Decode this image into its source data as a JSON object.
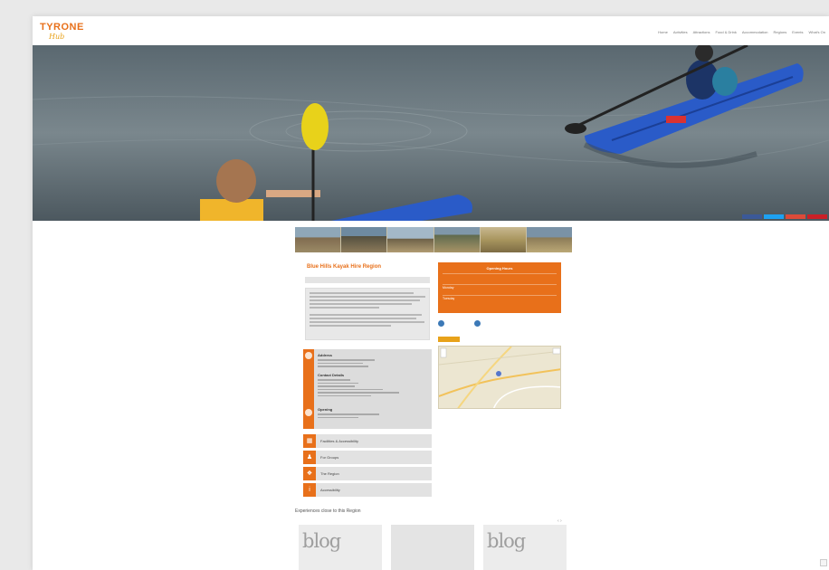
{
  "brand": {
    "logo_main": "TYRONE",
    "logo_sub": "Hub"
  },
  "nav": {
    "top_right": "",
    "items": [
      "Home",
      "Activities",
      "Attractions",
      "Food & Drink",
      "Accommodation",
      "Regions",
      "Events",
      "What's On"
    ]
  },
  "share_colors": [
    "#3b5998",
    "#1da1f2",
    "#dd4b39",
    "#cb2027"
  ],
  "page": {
    "title": "Blue Hills Kayak Hire Region",
    "subtitle": ""
  },
  "info": {
    "address_label": "Address",
    "contact_label": "Contact Details",
    "hours_label": "Opening"
  },
  "accordions": [
    {
      "icon": "calendar-icon",
      "glyph": "▦",
      "label": "Facilities & Accessibility"
    },
    {
      "icon": "people-icon",
      "glyph": "♟",
      "label": "For Groups"
    },
    {
      "icon": "tag-icon",
      "glyph": "❖",
      "label": "The Region"
    },
    {
      "icon": "info-icon",
      "glyph": "i",
      "label": "Accessibility"
    }
  ],
  "hours": {
    "title": "Opening Hours",
    "rows": [
      {
        "label": "",
        "values": [
          "",
          "",
          "",
          ""
        ]
      },
      {
        "label": "Monday",
        "values": [
          "",
          "",
          "",
          ""
        ]
      },
      {
        "label": "Tuesday",
        "values": [
          "",
          "",
          "",
          ""
        ]
      }
    ]
  },
  "badges": {
    "left": "",
    "right": ""
  },
  "nearby": {
    "title": "Experiences close to this Region",
    "arrows": "‹ ›",
    "cards": [
      "blog",
      "",
      "blog"
    ]
  },
  "colors": {
    "accent": "#e8701a",
    "accent_light": "#e8a21a",
    "panel": "#dcdcdc"
  }
}
